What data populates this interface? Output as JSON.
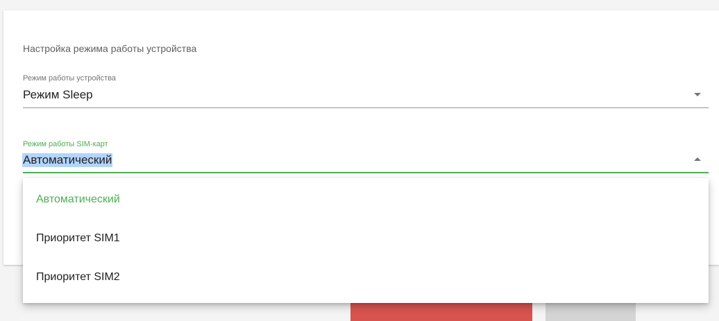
{
  "settings": {
    "section_title": "Настройка режима работы устройства",
    "device_mode": {
      "label": "Режим работы устройства",
      "value": "Режим Sleep"
    },
    "sim_mode": {
      "label": "Режим работы SIM-карт",
      "value": "Автоматический"
    }
  },
  "dropdown": {
    "options": [
      {
        "label": "Автоматический",
        "selected": true
      },
      {
        "label": "Приоритет SIM1",
        "selected": false
      },
      {
        "label": "Приоритет SIM2",
        "selected": false
      }
    ]
  },
  "colors": {
    "accent": "#4caf50",
    "danger": "#d9534f",
    "neutral_button": "#d4d4d4",
    "selection_highlight": "#b3d4fc"
  }
}
